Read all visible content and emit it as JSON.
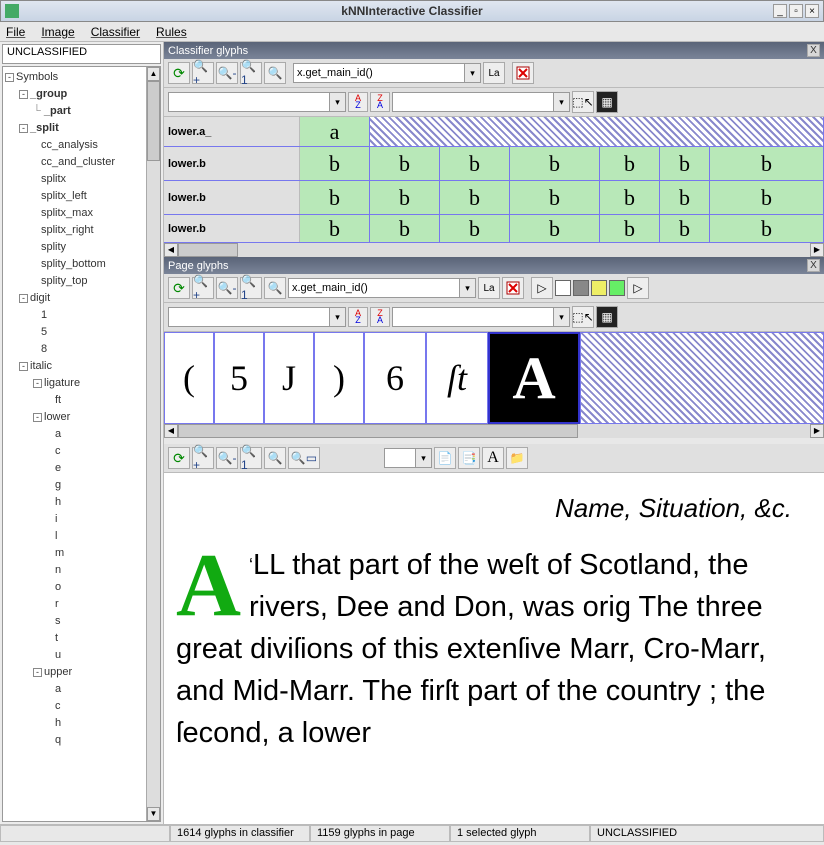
{
  "window": {
    "title": "kNNInteractive Classifier"
  },
  "menu": {
    "file": "File",
    "image": "Image",
    "classifier": "Classifier",
    "rules": "Rules"
  },
  "classification_label": "UNCLASSIFIED",
  "tree": {
    "root": "Symbols",
    "items": [
      "_group",
      "_part",
      "_split",
      "cc_analysis",
      "cc_and_cluster",
      "splitx",
      "splitx_left",
      "splitx_max",
      "splitx_right",
      "splity",
      "splity_bottom",
      "splity_top",
      "digit",
      "1",
      "5",
      "8",
      "italic",
      "ligature",
      "ft",
      "lower",
      "a",
      "c",
      "e",
      "g",
      "h",
      "i",
      "l",
      "m",
      "n",
      "o",
      "r",
      "s",
      "t",
      "u",
      "upper",
      "a",
      "c",
      "h",
      "q"
    ]
  },
  "classifier_panel": {
    "title": "Classifier glyphs",
    "expr": "x.get_main_id()",
    "rows": [
      {
        "label": "lower.a_",
        "glyphs": [
          "a"
        ]
      },
      {
        "label": "lower.b",
        "glyphs": [
          "b",
          "b",
          "b",
          "b",
          "b",
          "b",
          "b"
        ]
      },
      {
        "label": "lower.b",
        "glyphs": [
          "b",
          "b",
          "b",
          "b",
          "b",
          "b",
          "b"
        ]
      },
      {
        "label": "lower.b",
        "glyphs": [
          "b",
          "b",
          "b",
          "b",
          "b",
          "b",
          "b"
        ]
      }
    ]
  },
  "page_panel": {
    "title": "Page glyphs",
    "expr": "x.get_main_id()",
    "glyphs": [
      "(",
      "5",
      "J",
      ")",
      "6",
      "ſt",
      "A"
    ]
  },
  "doc": {
    "heading": "Name, Situation, &c.",
    "dropcap": "A",
    "text": "LL that part of the weſt of Scotland, the rivers, Dee and Don, was orig The three great diviſions of this extenſive Marr, Cro-Marr, and Mid-Marr. The firſt part of the country ; the ſecond, a lower"
  },
  "status": {
    "s1": "1614 glyphs in classifier",
    "s2": "1159 glyphs in page",
    "s3": "1 selected glyph",
    "s4": "UNCLASSIFIED"
  },
  "labels": {
    "la": "La"
  }
}
